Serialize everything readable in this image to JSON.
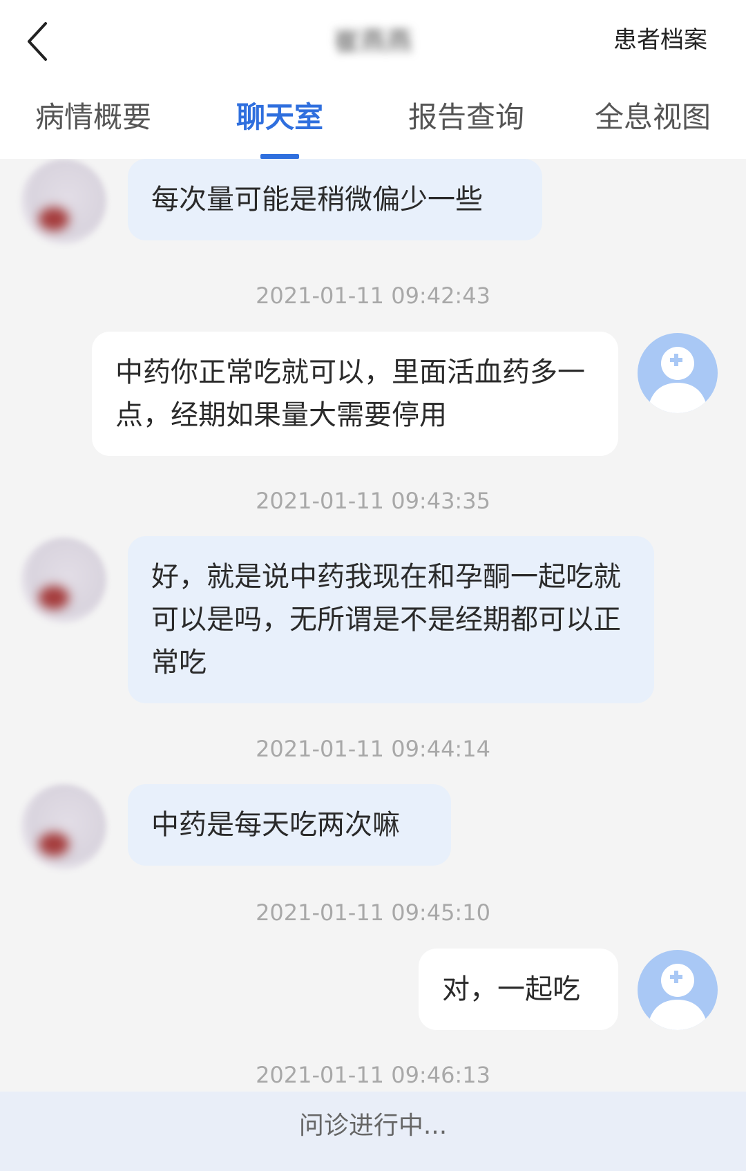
{
  "header": {
    "title": "崔燕燕",
    "archive_label": "患者档案"
  },
  "tabs": [
    {
      "label": "病情概要",
      "active": false
    },
    {
      "label": "聊天室",
      "active": true
    },
    {
      "label": "报告查询",
      "active": false
    },
    {
      "label": "全息视图",
      "active": false
    }
  ],
  "messages": [
    {
      "sender": "patient",
      "text": "每次量可能是稍微偏少一些",
      "time": "2021-01-11 09:42:43"
    },
    {
      "sender": "doctor",
      "text": "中药你正常吃就可以，里面活血药多一点，经期如果量大需要停用",
      "time": "2021-01-11 09:43:35"
    },
    {
      "sender": "patient",
      "text": "好，就是说中药我现在和孕酮一起吃就可以是吗，无所谓是不是经期都可以正常吃",
      "time": "2021-01-11 09:44:14"
    },
    {
      "sender": "patient",
      "text": "中药是每天吃两次嘛",
      "time": "2021-01-11 09:45:10"
    },
    {
      "sender": "doctor",
      "text": "对，一起吃",
      "time": "2021-01-11 09:46:13"
    }
  ],
  "footer": {
    "status": "问诊进行中..."
  },
  "colors": {
    "accent": "#2f6fde",
    "patient_bubble": "#e8f0fb",
    "doctor_bubble": "#ffffff",
    "doctor_avatar": "#a9c8f5"
  }
}
